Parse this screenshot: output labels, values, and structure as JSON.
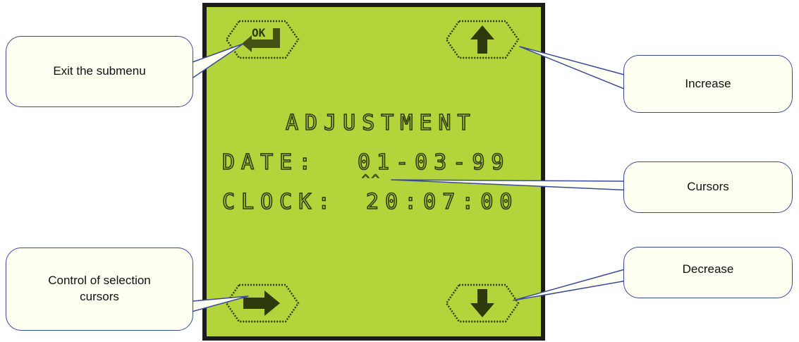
{
  "lcd": {
    "title": "ADJUSTMENT",
    "date_label": "DATE:",
    "date_value": "01-03-99",
    "cursor_marks": "^^",
    "clock_label": "CLOCK:",
    "clock_value": "20:07:00",
    "ok_key_label": "OK",
    "colors": {
      "screen": "#b3d43a",
      "segment": "#2f3a0c",
      "frame": "#1c1c1c"
    },
    "keys": [
      "ok-enter-icon",
      "arrow-up-icon",
      "arrow-right-icon",
      "arrow-down-icon"
    ]
  },
  "callouts": {
    "exit": "Exit the submenu",
    "increase": "Increase",
    "cursors": "Cursors",
    "control": "Control of selection cursors",
    "decrease": "Decrease"
  },
  "colors": {
    "callout_border": "#3a4a9a",
    "callout_fill": "#fffff2"
  }
}
